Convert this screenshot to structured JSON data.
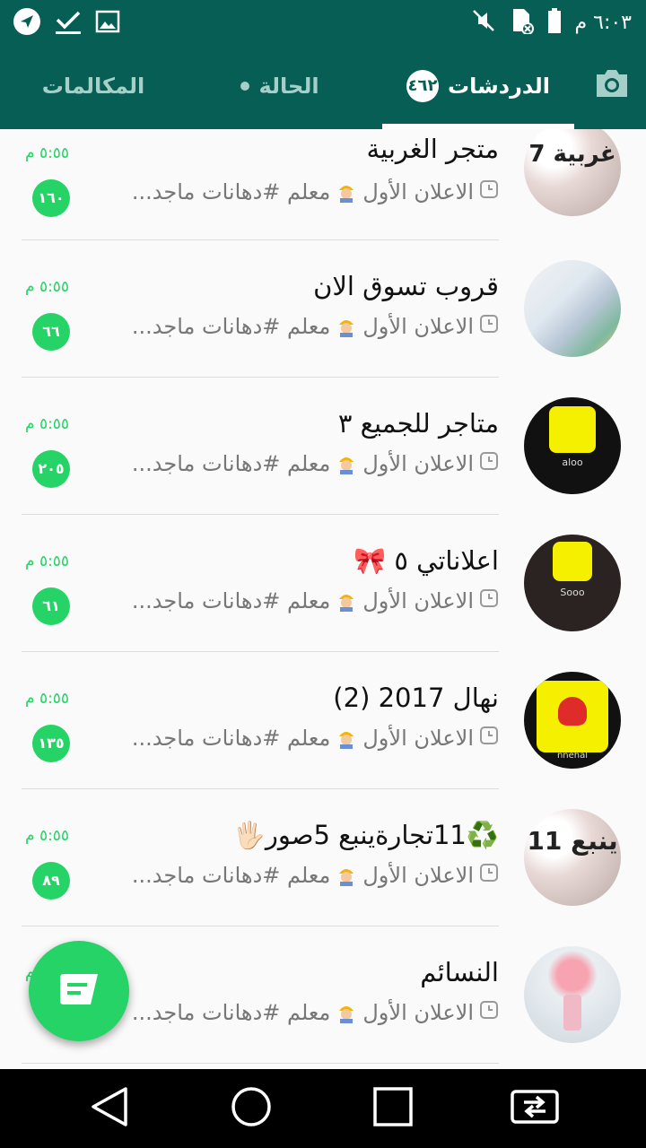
{
  "status_bar": {
    "time": "٦:٠٣ م"
  },
  "tabs": {
    "chats_label": "الدردشات",
    "chats_badge": "٤٦٢",
    "status_label": "الحالة",
    "calls_label": "المكالمات"
  },
  "colors": {
    "primary": "#075e54",
    "accent": "#25d366"
  },
  "chats": [
    {
      "name": "متجر الغربية",
      "preview_author": "الاعلان الأول",
      "preview_text": "معلم #دهانات ماجد...",
      "time": "٥:٥٥ م",
      "unread": "١٦٠",
      "avatar_text": "7 غربية"
    },
    {
      "name": "قروب تسوق الان",
      "preview_author": "الاعلان الأول",
      "preview_text": "معلم #دهانات ماجد...",
      "time": "٥:٥٥ م",
      "unread": "٦٦"
    },
    {
      "name": "متاجر للجميع ٣",
      "preview_author": "الاعلان الأول",
      "preview_text": "معلم #دهانات ماجد...",
      "time": "٥:٥٥ م",
      "unread": "٢٠٥",
      "avatar_text": "aloo"
    },
    {
      "name": "اعلاناتي ٥ 🎀",
      "preview_author": "الاعلان الأول",
      "preview_text": "معلم #دهانات ماجد...",
      "time": "٥:٥٥ م",
      "unread": "٦١",
      "avatar_text": "Sooo"
    },
    {
      "name": "نهال 2017 (2)",
      "preview_author": "الاعلان الأول",
      "preview_text": "معلم #دهانات ماجد...",
      "time": "٥:٥٥ م",
      "unread": "١٣٥",
      "avatar_text": "nnehal"
    },
    {
      "name": "♻️11تجارةينبع 5صور🖐🏻",
      "preview_author": "الاعلان الأول",
      "preview_text": "معلم #دهانات ماجد...",
      "time": "٥:٥٥ م",
      "unread": "٨٩",
      "avatar_text": "11 ينبع"
    },
    {
      "name": "النسائم",
      "preview_author": "الاعلان الأول",
      "preview_text": "معلم #دهانات ماجد...",
      "time": "٥:٥٥ م",
      "unread": ""
    }
  ]
}
